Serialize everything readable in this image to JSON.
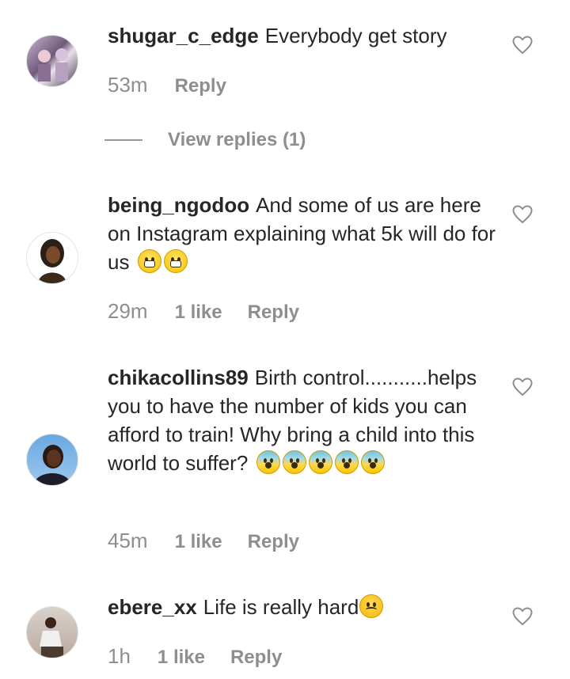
{
  "comments": [
    {
      "username": "shugar_c_edge",
      "text": "Everybody get story",
      "time": "53m",
      "likes": "",
      "reply_label": "Reply",
      "view_replies": "View replies (1)"
    },
    {
      "username": "being_ngodoo",
      "text": "And some of us are here on Instagram explaining what 5k will do for us",
      "time": "29m",
      "likes": "1 like",
      "reply_label": "Reply"
    },
    {
      "username": "chikacollins89",
      "text": "Birth control...........helps you to have the number of kids you can afford to train! Why bring a child into this world to suffer?",
      "time": "45m",
      "likes": "1 like",
      "reply_label": "Reply"
    },
    {
      "username": "ebere_xx",
      "text": "Life is really hard",
      "time": "1h",
      "likes": "1 like",
      "reply_label": "Reply"
    }
  ],
  "icons": {
    "like": "heart-outline-icon",
    "grin": "grinning-face-emoji",
    "fear": "fearful-face-emoji",
    "sad": "sad-relieved-face-emoji"
  },
  "colors": {
    "text": "#262626",
    "secondary": "#8e8e8e"
  }
}
